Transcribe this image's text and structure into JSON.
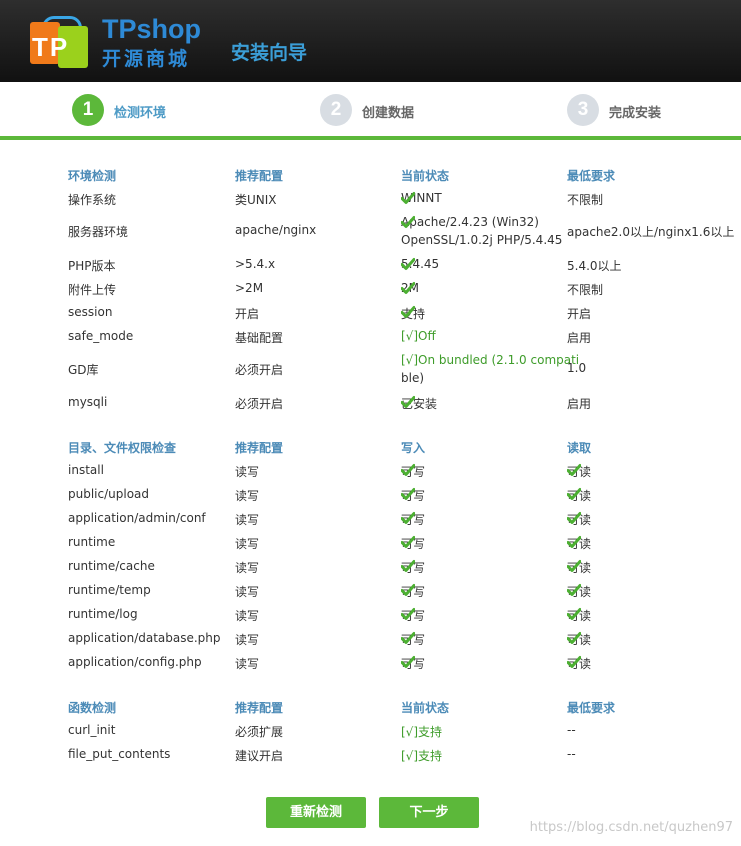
{
  "header": {
    "logo_letters": "TP",
    "brand": "TPshop",
    "brand_sub": "开源商城",
    "title": "安装向导"
  },
  "steps": [
    {
      "num": "1",
      "label": "检测环境"
    },
    {
      "num": "2",
      "label": "创建数据"
    },
    {
      "num": "3",
      "label": "完成安装"
    }
  ],
  "env": {
    "headers": [
      "环境检测",
      "推荐配置",
      "当前状态",
      "最低要求"
    ],
    "rows": [
      {
        "name": "操作系统",
        "recommend": "类UNIX",
        "status": "WINNT",
        "min": "不限制"
      },
      {
        "name": "服务器环境",
        "recommend": "apache/nginx",
        "status": "Apache/2.4.23 (Win32)",
        "status2": "OpenSSL/1.0.2j PHP/5.4.45",
        "min": "apache2.0以上/nginx1.6以上"
      },
      {
        "name": "PHP版本",
        "recommend": ">5.4.x",
        "status": "5.4.45",
        "min": "5.4.0以上"
      },
      {
        "name": "附件上传",
        "recommend": ">2M",
        "status": "2M",
        "min": "不限制"
      },
      {
        "name": "session",
        "recommend": "开启",
        "status": "支持",
        "min": "开启"
      },
      {
        "name": "safe_mode",
        "recommend": "基础配置",
        "status": "[√]Off",
        "min": "启用"
      },
      {
        "name": "GD库",
        "recommend": "必须开启",
        "status": "[√]On bundled (2.1.0 compati",
        "status2": "ble)",
        "min": "1.0"
      },
      {
        "name": "mysqli",
        "recommend": "必须开启",
        "status": "已安装",
        "min": "启用"
      }
    ]
  },
  "dirs": {
    "headers": [
      "目录、文件权限检查",
      "推荐配置",
      "写入",
      "读取"
    ],
    "rows": [
      {
        "path": "install",
        "recommend": "读写",
        "write": "可写",
        "read": "可读"
      },
      {
        "path": "public/upload",
        "recommend": "读写",
        "write": "可写",
        "read": "可读"
      },
      {
        "path": "application/admin/conf",
        "recommend": "读写",
        "write": "可写",
        "read": "可读"
      },
      {
        "path": "runtime",
        "recommend": "读写",
        "write": "可写",
        "read": "可读"
      },
      {
        "path": "runtime/cache",
        "recommend": "读写",
        "write": "可写",
        "read": "可读"
      },
      {
        "path": "runtime/temp",
        "recommend": "读写",
        "write": "可写",
        "read": "可读"
      },
      {
        "path": "runtime/log",
        "recommend": "读写",
        "write": "可写",
        "read": "可读"
      },
      {
        "path": "application/database.php",
        "recommend": "读写",
        "write": "可写",
        "read": "可读"
      },
      {
        "path": "application/config.php",
        "recommend": "读写",
        "write": "可写",
        "read": "可读"
      }
    ]
  },
  "funcs": {
    "headers": [
      "函数检测",
      "推荐配置",
      "当前状态",
      "最低要求"
    ],
    "rows": [
      {
        "name": "curl_init",
        "recommend": "必须扩展",
        "status": "[√]支持",
        "min": "--"
      },
      {
        "name": "file_put_contents",
        "recommend": "建议开启",
        "status": "[√]支持",
        "min": "--"
      }
    ]
  },
  "buttons": {
    "recheck": "重新检测",
    "next": "下一步"
  },
  "watermark": "https://blog.csdn.net/quzhen97",
  "colors": {
    "accent_green": "#5cb83a",
    "header_blue": "#4c8bb7",
    "header_bg": "#1b1b1b"
  }
}
